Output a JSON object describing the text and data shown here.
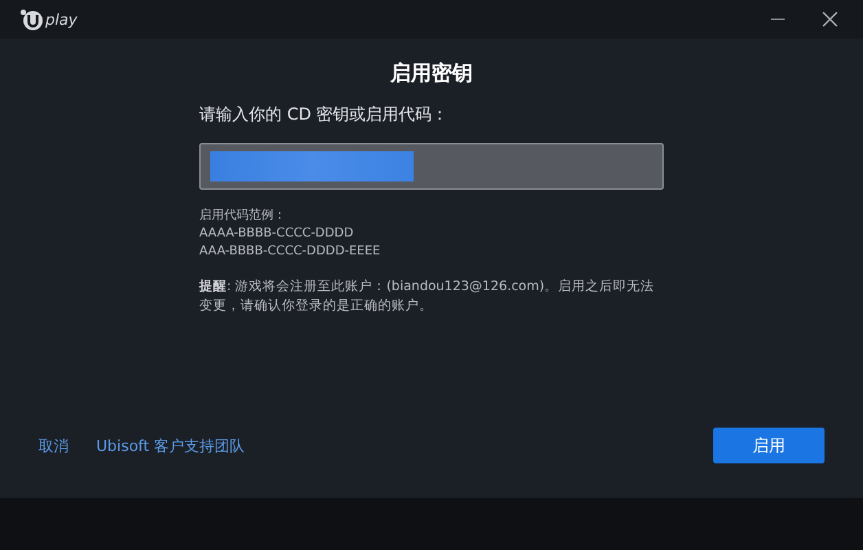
{
  "window": {
    "logo_text": "play"
  },
  "dialog": {
    "title": "启用密钥",
    "prompt": "请输入你的 CD 密钥或启用代码：",
    "key_field": {
      "redacted": true
    },
    "examples_label": "启用代码范例：",
    "examples": [
      "AAAA-BBBB-CCCC-DDDD",
      "AAA-BBBB-CCCC-DDDD-EEEE"
    ],
    "notice": "**提醒**: 游戏将会注册至此账户：(biandou123@126.com)。启用之后即无法变更，请确认你登录的是正确的账户。"
  },
  "footer": {
    "cancel": "取消",
    "support_link": "Ubisoft 客户支持团队",
    "activate_button": "启用"
  }
}
